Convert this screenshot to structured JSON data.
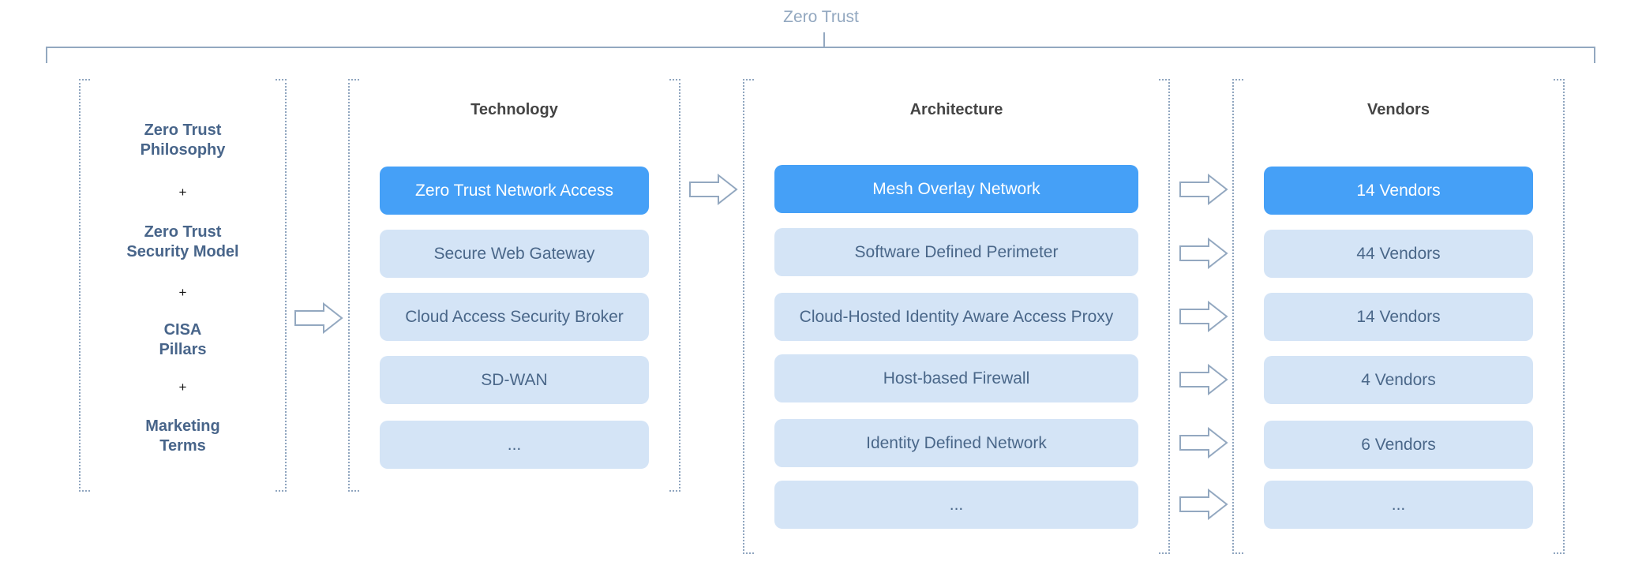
{
  "title": "Zero Trust",
  "concepts": {
    "items": [
      {
        "line1": "Zero Trust",
        "line2": "Philosophy"
      },
      {
        "line1": "Zero Trust",
        "line2": "Security Model"
      },
      {
        "line1": "CISA",
        "line2": "Pillars"
      },
      {
        "line1": "Marketing",
        "line2": "Terms"
      }
    ],
    "joiner": "+"
  },
  "technology": {
    "heading": "Technology",
    "items": [
      {
        "label": "Zero Trust Network Access",
        "highlighted": true
      },
      {
        "label": "Secure Web Gateway",
        "highlighted": false
      },
      {
        "label": "Cloud Access Security Broker",
        "highlighted": false
      },
      {
        "label": "SD-WAN",
        "highlighted": false
      },
      {
        "label": "...",
        "highlighted": false
      }
    ]
  },
  "architecture": {
    "heading": "Architecture",
    "items": [
      {
        "label": "Mesh Overlay Network",
        "highlighted": true
      },
      {
        "label": "Software Defined Perimeter",
        "highlighted": false
      },
      {
        "label": "Cloud-Hosted Identity Aware Access Proxy",
        "highlighted": false
      },
      {
        "label": "Host-based Firewall",
        "highlighted": false
      },
      {
        "label": "Identity Defined Network",
        "highlighted": false
      },
      {
        "label": "...",
        "highlighted": false
      }
    ]
  },
  "vendors": {
    "heading": "Vendors",
    "items": [
      {
        "label": "14 Vendors",
        "highlighted": true
      },
      {
        "label": "44 Vendors",
        "highlighted": false
      },
      {
        "label": "14 Vendors",
        "highlighted": false
      },
      {
        "label": "4 Vendors",
        "highlighted": false
      },
      {
        "label": "6 Vendors",
        "highlighted": false
      },
      {
        "label": "...",
        "highlighted": false
      }
    ]
  },
  "colors": {
    "highlight": "#45a0f7",
    "box": "#d4e4f6",
    "box_text": "#4a6789",
    "outline": "#93a8c0"
  }
}
